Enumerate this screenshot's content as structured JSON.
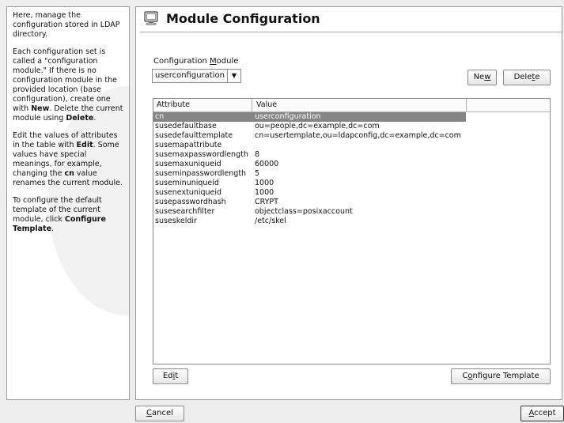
{
  "help": {
    "p1": "Here, manage the configuration stored in LDAP directory.",
    "p2_pre": "Each configuration set is called a \"configuration module.\" If there is no configuration module in the provided location (base configuration), create one with ",
    "p2_new": "New",
    "p2_mid": ". Delete the current module using ",
    "p2_delete": "Delete",
    "p2_end": ".",
    "p3_pre": "Edit the values of attributes in the table with ",
    "p3_edit": "Edit",
    "p3_mid": ". Some values have special meanings, for example, changing the ",
    "p3_cn": "cn",
    "p3_end": " value renames the current module.",
    "p4_pre": "To configure the default template of the current module, click ",
    "p4_bold": "Configure Template",
    "p4_end": "."
  },
  "title": "Module Configuration",
  "module_label": {
    "pre": "Configuration ",
    "mnemonic": "M",
    "post": "odule"
  },
  "module_select": {
    "value": "userconfiguration"
  },
  "buttons": {
    "new": {
      "pre": "Ne",
      "mnemonic": "w",
      "post": ""
    },
    "delete": {
      "pre": "Dele",
      "mnemonic": "t",
      "post": "e"
    },
    "edit": {
      "pre": "Ed",
      "mnemonic": "i",
      "post": "t"
    },
    "configure_template": {
      "pre": "C",
      "mnemonic": "o",
      "post": "nfigure Template"
    },
    "cancel": {
      "pre": "",
      "mnemonic": "C",
      "post": "ancel"
    },
    "accept": {
      "pre": "",
      "mnemonic": "A",
      "post": "ccept"
    }
  },
  "table": {
    "columns": [
      "Attribute",
      "Value"
    ],
    "rows": [
      {
        "attribute": "cn",
        "value": "userconfiguration",
        "selected": true
      },
      {
        "attribute": "susedefaultbase",
        "value": "ou=people,dc=example,dc=com"
      },
      {
        "attribute": "susedefaulttemplate",
        "value": "cn=usertemplate,ou=ldapconfig,dc=example,dc=com"
      },
      {
        "attribute": "susemapattribute",
        "value": ""
      },
      {
        "attribute": "susemaxpasswordlength",
        "value": "8"
      },
      {
        "attribute": "susemaxuniqueid",
        "value": "60000"
      },
      {
        "attribute": "suseminpasswordlength",
        "value": "5"
      },
      {
        "attribute": "suseminuniqueid",
        "value": "1000"
      },
      {
        "attribute": "susenextuniqueid",
        "value": "1000"
      },
      {
        "attribute": "susepasswordhash",
        "value": "CRYPT"
      },
      {
        "attribute": "susesearchfilter",
        "value": "objectclass=posixaccount"
      },
      {
        "attribute": "suseskeldir",
        "value": "/etc/skel"
      }
    ]
  },
  "colors": {
    "selection": "#858585",
    "border": "#8a8a8a"
  }
}
